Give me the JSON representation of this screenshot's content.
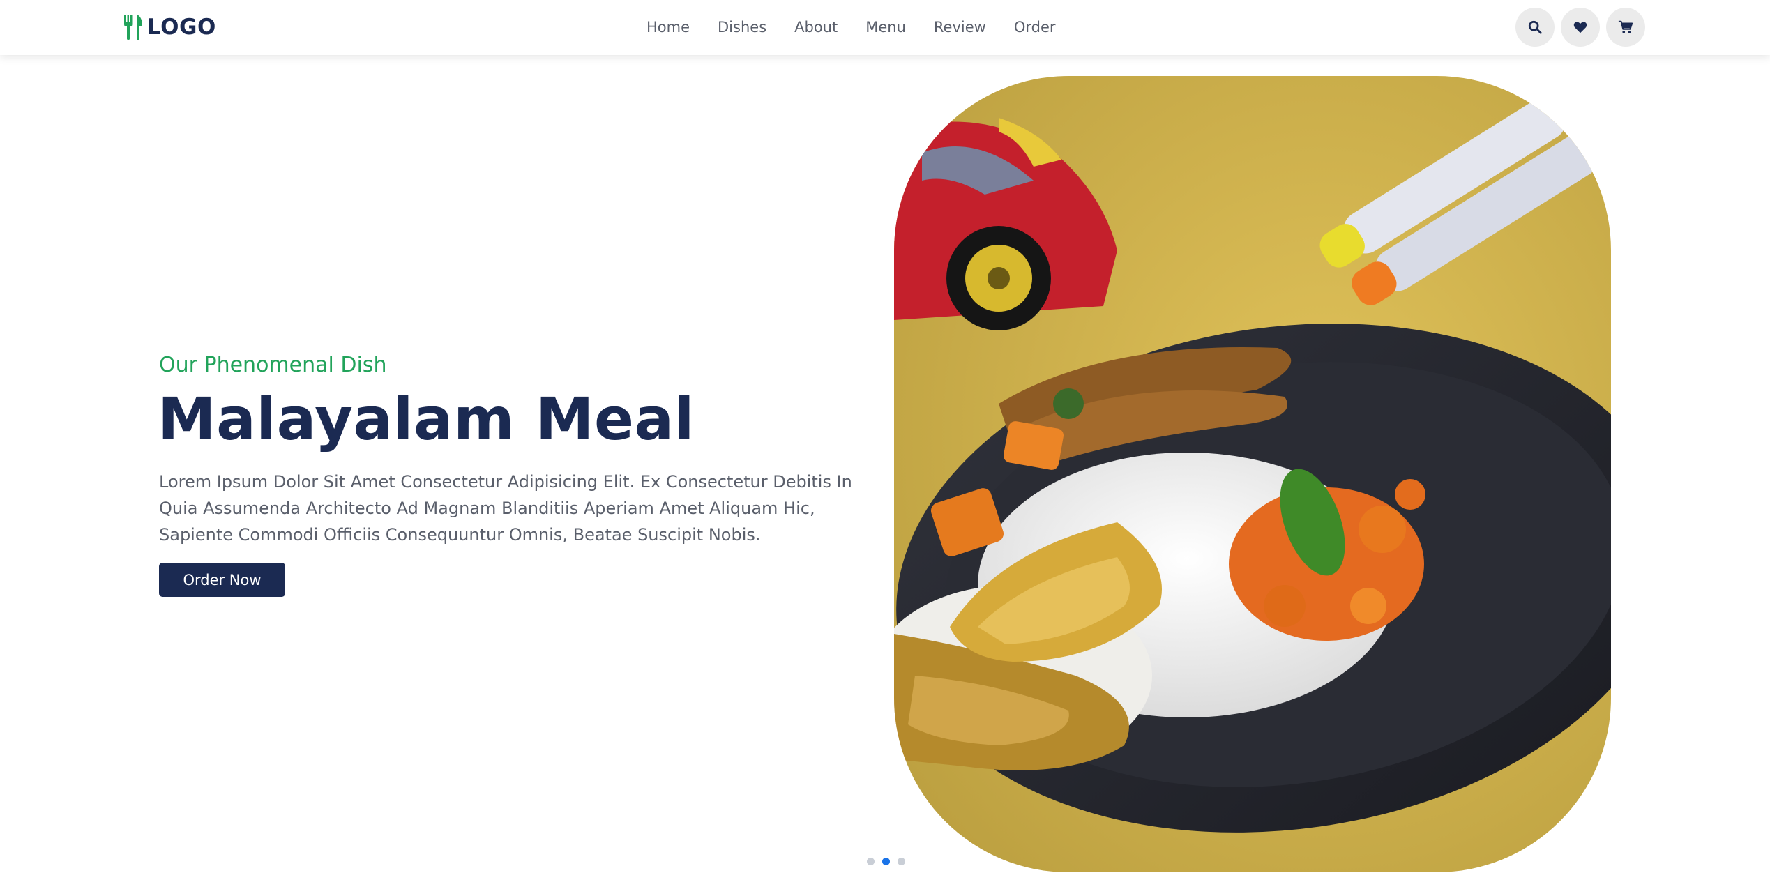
{
  "header": {
    "logo_text": "LOGO",
    "logo_icon": "fork-knife-icon",
    "nav": [
      "Home",
      "Dishes",
      "About",
      "Menu",
      "Review",
      "Order"
    ],
    "icons": [
      "search-icon",
      "heart-icon",
      "cart-icon"
    ]
  },
  "hero": {
    "subtitle": "Our Phenomenal Dish",
    "title": "Malayalam Meal",
    "description": "Lorem Ipsum Dolor Sit Amet Consectetur Adipisicing Elit. Ex Consectetur Debitis In Quia Assumenda Architecto Ad Magnam Blanditiis Aperiam Amet Aliquam Hic, Sapiente Commodi Officiis Consequuntur Omnis, Beatae Suscipit Nobis.",
    "cta_label": "Order Now"
  },
  "carousel": {
    "slide_count": 3,
    "active_index": 1
  },
  "colors": {
    "brand_navy": "#1b2a52",
    "accent_green": "#21a35a",
    "text_gray": "#5a5f6b",
    "dot_active": "#1a73e8",
    "dot_inactive": "#c9ced6"
  }
}
